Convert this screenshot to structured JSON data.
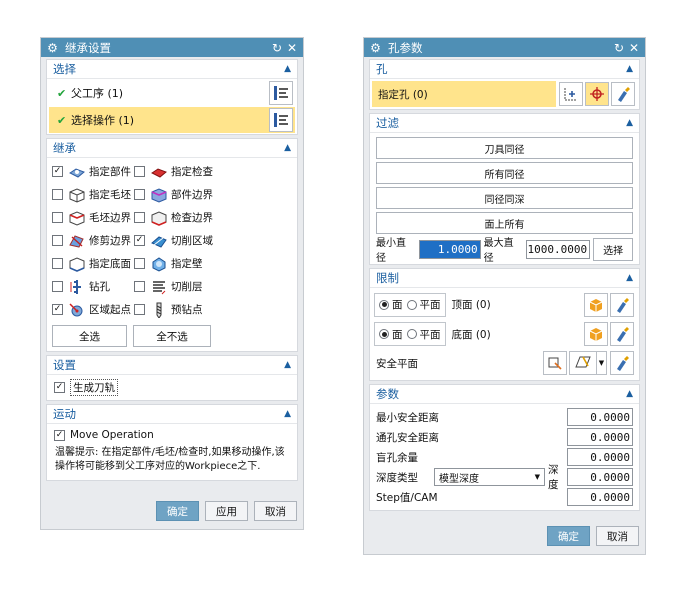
{
  "left": {
    "title": "继承设置",
    "sel": {
      "header": "选择",
      "row1": "父工序 (1)",
      "row2": "选择操作 (1)"
    },
    "inh": {
      "header": "继承",
      "items": [
        {
          "label": "指定部件",
          "checked": true
        },
        {
          "label": "指定检查",
          "checked": false
        },
        {
          "label": "指定毛坯",
          "checked": false
        },
        {
          "label": "部件边界",
          "checked": false
        },
        {
          "label": "毛坯边界",
          "checked": false
        },
        {
          "label": "检查边界",
          "checked": false
        },
        {
          "label": "修剪边界",
          "checked": false
        },
        {
          "label": "切削区域",
          "checked": true
        },
        {
          "label": "指定底面",
          "checked": false
        },
        {
          "label": "指定壁",
          "checked": false
        },
        {
          "label": "钻孔",
          "checked": false
        },
        {
          "label": "切削层",
          "checked": false
        },
        {
          "label": "区域起点",
          "checked": true
        },
        {
          "label": "预钻点",
          "checked": false
        }
      ],
      "btn_all": "全选",
      "btn_none": "全不选"
    },
    "set": {
      "header": "设置",
      "gen": "生成刀轨",
      "checked": true
    },
    "mot": {
      "header": "运动",
      "move": "Move Operation",
      "checked": true,
      "hint": "温馨提示: 在指定部件/毛坯/检查时,如果移动操作,该操作将可能移到父工序对应的Workpiece之下."
    },
    "ok": "确定",
    "apply": "应用",
    "cancel": "取消"
  },
  "right": {
    "title": "孔参数",
    "hole": {
      "header": "孔",
      "spec": "指定孔 (0)"
    },
    "filt": {
      "header": "过滤",
      "b1": "刀具同径",
      "b2": "所有同径",
      "b3": "同径同深",
      "b4": "面上所有",
      "min_label": "最小直径",
      "min_val": "1.0000",
      "max_label": "最大直径",
      "max_val": "1000.0000",
      "select": "选择"
    },
    "lim": {
      "header": "限制",
      "face": "面",
      "plane": "平面",
      "top": "顶面 (0)",
      "bottom": "底面 (0)",
      "safe": "安全平面"
    },
    "par": {
      "header": "参数",
      "min_safe": "最小安全距离",
      "min_safe_val": "0.0000",
      "thru_safe": "通孔安全距离",
      "thru_safe_val": "0.0000",
      "blind": "盲孔余量",
      "blind_val": "0.0000",
      "depth_type": "深度类型",
      "depth_opt": "模型深度",
      "depth": "深度",
      "depth_val": "0.0000",
      "step": "Step值/CAM",
      "step_val": "0.0000"
    },
    "ok": "确定",
    "cancel": "取消"
  }
}
